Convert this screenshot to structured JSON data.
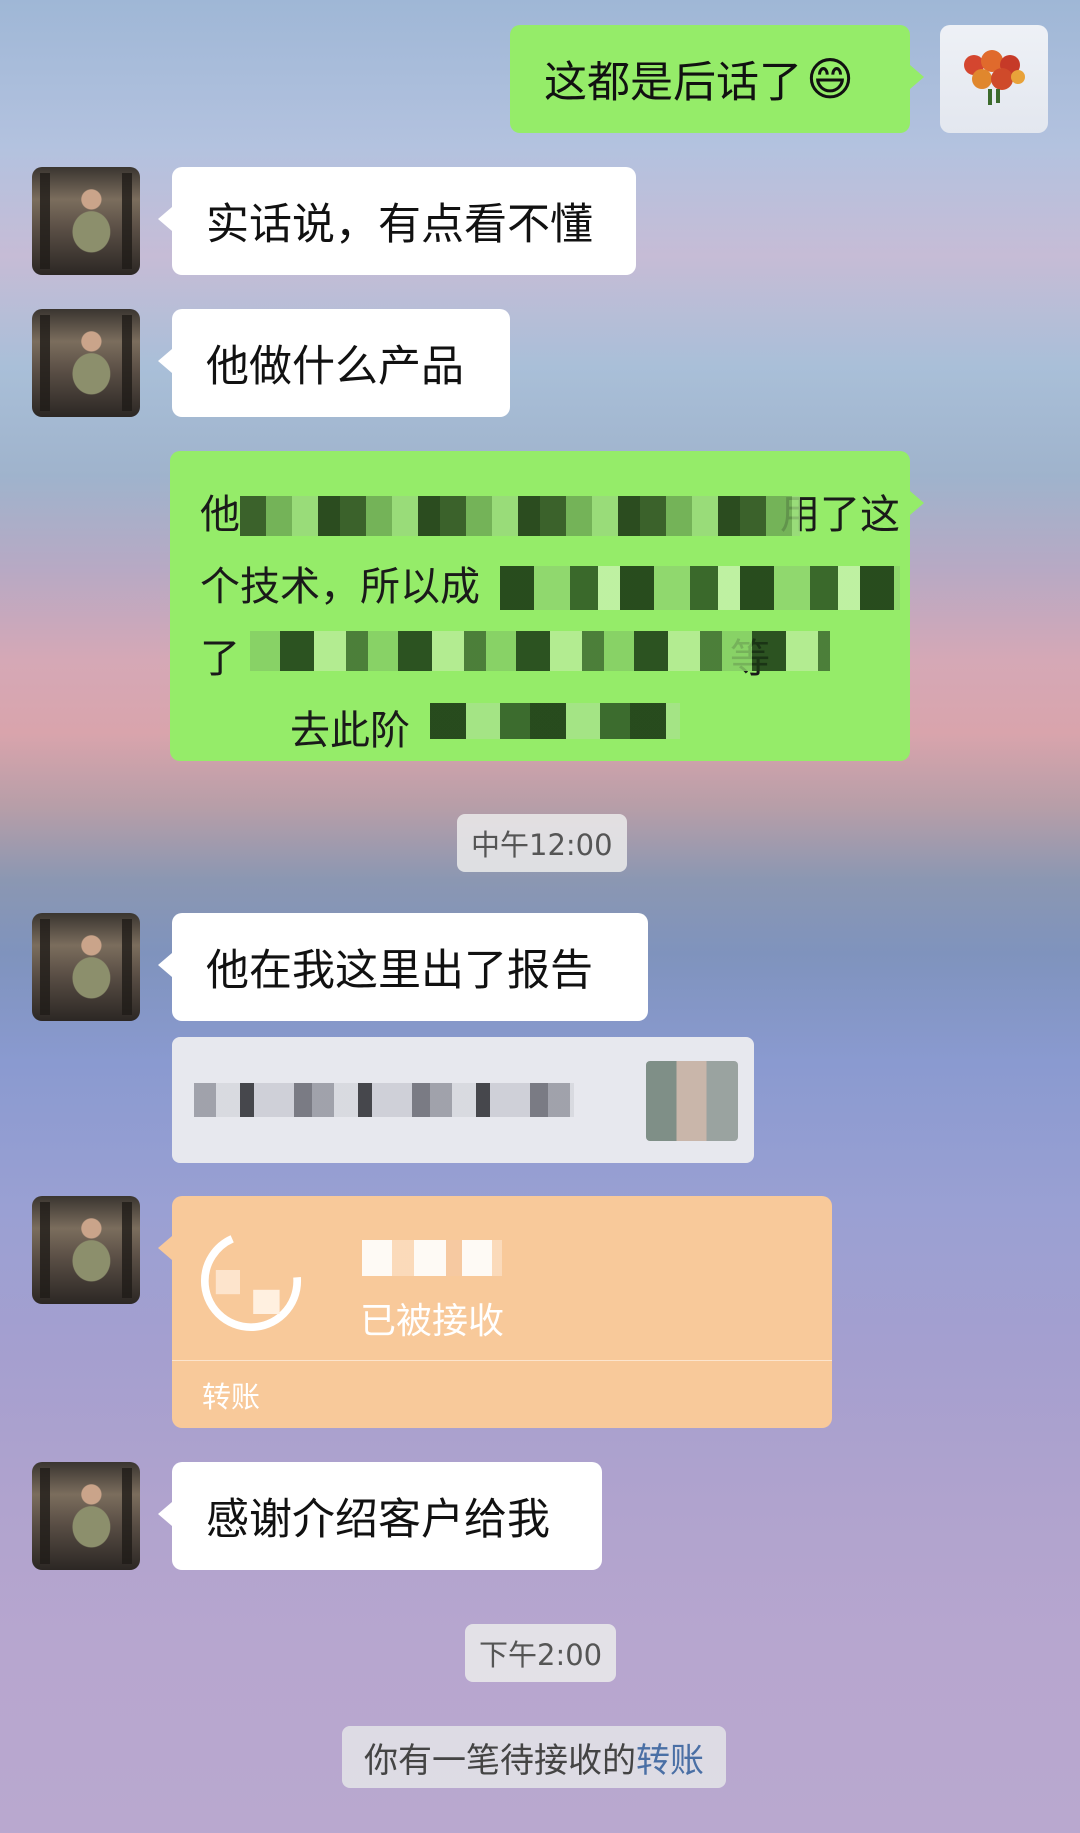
{
  "messages": {
    "m1": {
      "text": "这都是后话了",
      "emoji": "😄"
    },
    "m2": {
      "text": "实话说，有点看不懂"
    },
    "m3": {
      "text": "他做什么产品"
    },
    "m4": {
      "line1": "他",
      "line1_end": "用了这",
      "line2_a": "个技术，所以成",
      "line3_a": "了",
      "line3_b": "等",
      "line4_a": "去此阶"
    },
    "m5": {
      "text": "他在我这里出了报告"
    },
    "m7": {
      "text": "感谢介绍客户给我"
    }
  },
  "times": {
    "noon": "中午12:00",
    "afternoon": "下午2:00"
  },
  "transfer": {
    "status": "已被接收",
    "label": "转账"
  },
  "notice": {
    "prefix": "你有一笔待接收的",
    "link": "转账"
  },
  "colors": {
    "sent_bubble": "#95ec69",
    "received_bubble": "#ffffff",
    "transfer_bubble": "#f8c99a",
    "link": "#4a6fa5"
  }
}
